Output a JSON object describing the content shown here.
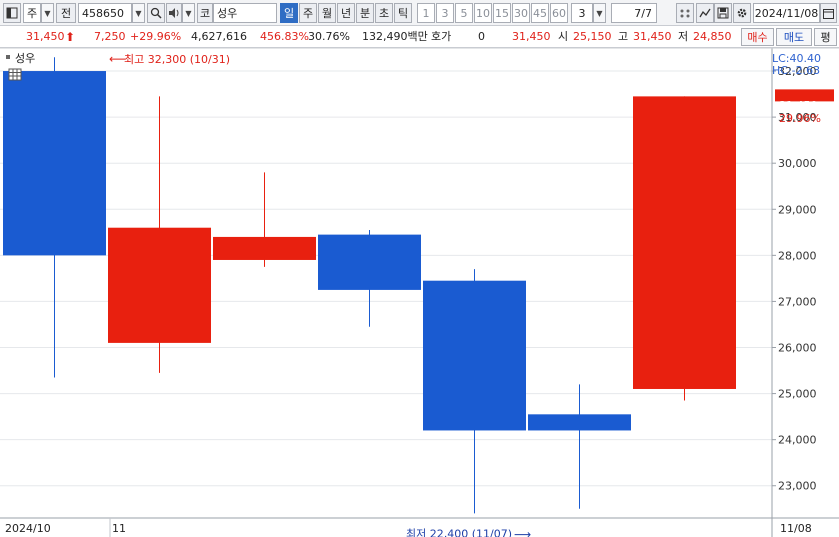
{
  "toolbar": {
    "type_label": "주",
    "jeon_label": "전",
    "code_value": "458650",
    "ko_label": "코",
    "stock_name": "성우",
    "periods": [
      "일",
      "주",
      "월",
      "년",
      "분",
      "초",
      "틱"
    ],
    "selected_period": "일",
    "intervals": [
      "1",
      "3",
      "5",
      "10",
      "15",
      "30",
      "45",
      "60"
    ],
    "count_value": "3",
    "page_value": "7/7",
    "date_value": "2024/11/08"
  },
  "quote": {
    "price": "31,450",
    "change": "7,250",
    "change_pct": "+29.96%",
    "volume": "4,627,616",
    "vol_ratio": "456.83%",
    "turnover": "30.76%",
    "amount": "132,490백만",
    "hoga_label": "호가",
    "hoga_value": "0",
    "hoga_price": "31,450",
    "open_label": "시",
    "open": "25,150",
    "high_label": "고",
    "high": "31,450",
    "low_label": "저",
    "low": "24,850",
    "buy_label": "매수",
    "sell_label": "매도",
    "eval_label": "평"
  },
  "chart_data": {
    "type": "candlestick",
    "title": "성우",
    "lc_label": "LC:40.40",
    "hc_label": "HC:-2.63",
    "y_ticks": [
      23000,
      24000,
      25000,
      26000,
      27000,
      28000,
      29000,
      30000,
      31000,
      32000
    ],
    "y_tick_labels": [
      "23,000",
      "24,000",
      "25,000",
      "26,000",
      "27,000",
      "28,000",
      "29,000",
      "30,000",
      "31,000",
      "32,000"
    ],
    "ylim": [
      22300,
      32500
    ],
    "x_labels": [
      "2024/10",
      "11",
      "11/08"
    ],
    "candles": [
      {
        "open": 32000,
        "high": 32300,
        "low": 25350,
        "close": 28000,
        "color": "#1a5bd1"
      },
      {
        "open": 26100,
        "high": 31450,
        "low": 25450,
        "close": 28600,
        "color": "#e8200f"
      },
      {
        "open": 27900,
        "high": 29800,
        "low": 27750,
        "close": 28400,
        "color": "#e8200f"
      },
      {
        "open": 28450,
        "high": 28550,
        "low": 26450,
        "close": 27250,
        "color": "#1a5bd1"
      },
      {
        "open": 27450,
        "high": 27700,
        "low": 22400,
        "close": 24200,
        "color": "#1a5bd1"
      },
      {
        "open": 24550,
        "high": 25200,
        "low": 22500,
        "close": 24200,
        "color": "#1a5bd1"
      },
      {
        "open": 25100,
        "high": 31450,
        "low": 24850,
        "close": 31450,
        "color": "#e8200f"
      }
    ],
    "annotations": {
      "high_text": "최고 32,300 (10/31)",
      "low_text": "최저 22,400 (11/07)"
    },
    "last_price_label": "31,450",
    "last_pct_label": "29.96%"
  }
}
